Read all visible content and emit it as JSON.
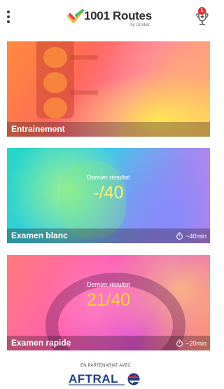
{
  "header": {
    "brand": "1001 Routes",
    "brand_sub": "by Ornikar",
    "trophy_badge": "1"
  },
  "cards": [
    {
      "title": "Entrainement"
    },
    {
      "title": "Examen blanc",
      "result_label": "Dernier résultat",
      "score": "-/40",
      "duration": "~40min"
    },
    {
      "title": "Examen rapide",
      "result_label": "Dernier résultat",
      "score": "21/40",
      "duration": "~20min"
    }
  ],
  "partner": {
    "label": "EN PARTENARIAT AVEC",
    "name": "AFTRAL"
  },
  "colors": {
    "score_blanc": "#fff36b",
    "score_rapide": "#ffd23a",
    "badge": "#e0322f",
    "aftral_blue": "#1e3d8f"
  }
}
